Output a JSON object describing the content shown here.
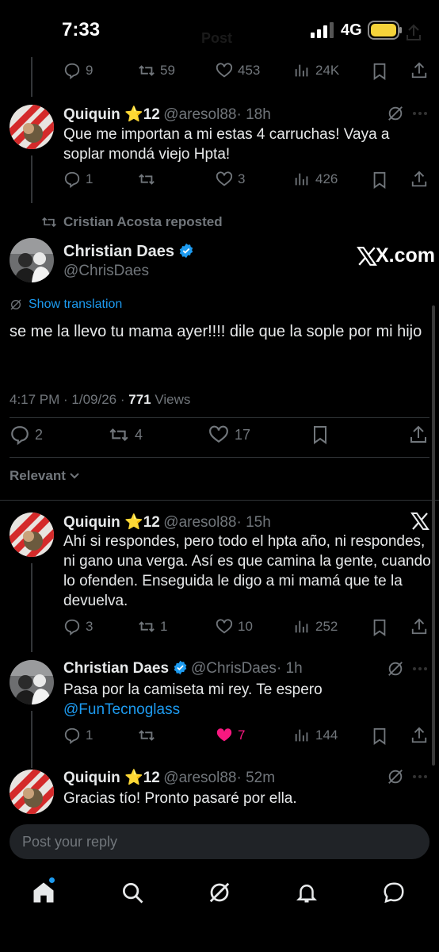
{
  "status_bar": {
    "time": "7:33",
    "network": "4G"
  },
  "top_header": {
    "title": "Post"
  },
  "tweet1": {
    "actions": {
      "replies": "9",
      "reposts": "59",
      "likes": "453",
      "views": "24K"
    }
  },
  "tweet2": {
    "name": "Quiquin ⭐12",
    "handle": "@aresol88",
    "time": "· 18h",
    "text": "Que me importan a mi estas 4 carruchas! Vaya a soplar mondá viejo Hpta!",
    "actions": {
      "replies": "1",
      "reposts": "",
      "likes": "3",
      "views": "426"
    }
  },
  "repost_label": "Cristian Acosta reposted",
  "main_tweet": {
    "name": "Christian Daes",
    "handle": "@ChrisDaes",
    "watermark": "X.com",
    "translate": "Show translation",
    "text": "se me la llevo tu mama ayer!!!!  dile que la sople por mi hijo",
    "meta_time": "4:17 PM · 1/09/26 ·",
    "views_count": "771",
    "views_label": "Views",
    "actions": {
      "replies": "2",
      "reposts": "4",
      "likes": "17"
    }
  },
  "sort_label": "Relevant",
  "reply1": {
    "name": "Quiquin ⭐12",
    "handle": "@aresol88",
    "time": "· 15h",
    "text": "Ahí si respondes, pero todo el hpta año, ni respondes, ni gano una verga. Así es que camina la gente, cuando lo ofenden. Enseguida le digo a mi mamá que te la devuelva.",
    "actions": {
      "replies": "3",
      "reposts": "1",
      "likes": "10",
      "views": "252"
    }
  },
  "reply2": {
    "name": "Christian Daes",
    "handle": "@ChrisDaes",
    "time": "· 1h",
    "text": "Pasa por la camiseta mi rey.  Te espero",
    "mention": "@FunTecnoglass",
    "actions": {
      "replies": "1",
      "reposts": "",
      "likes": "7",
      "views": "144"
    }
  },
  "reply3": {
    "name": "Quiquin ⭐12",
    "handle": "@aresol88",
    "time": "· 52m",
    "text": "Gracias tío! Pronto pasaré por ella."
  },
  "composer": {
    "placeholder": "Post your reply"
  },
  "colors": {
    "background": "#000000",
    "accent": "#1d9bf0",
    "like_active": "#f91880",
    "muted": "#71767b"
  }
}
